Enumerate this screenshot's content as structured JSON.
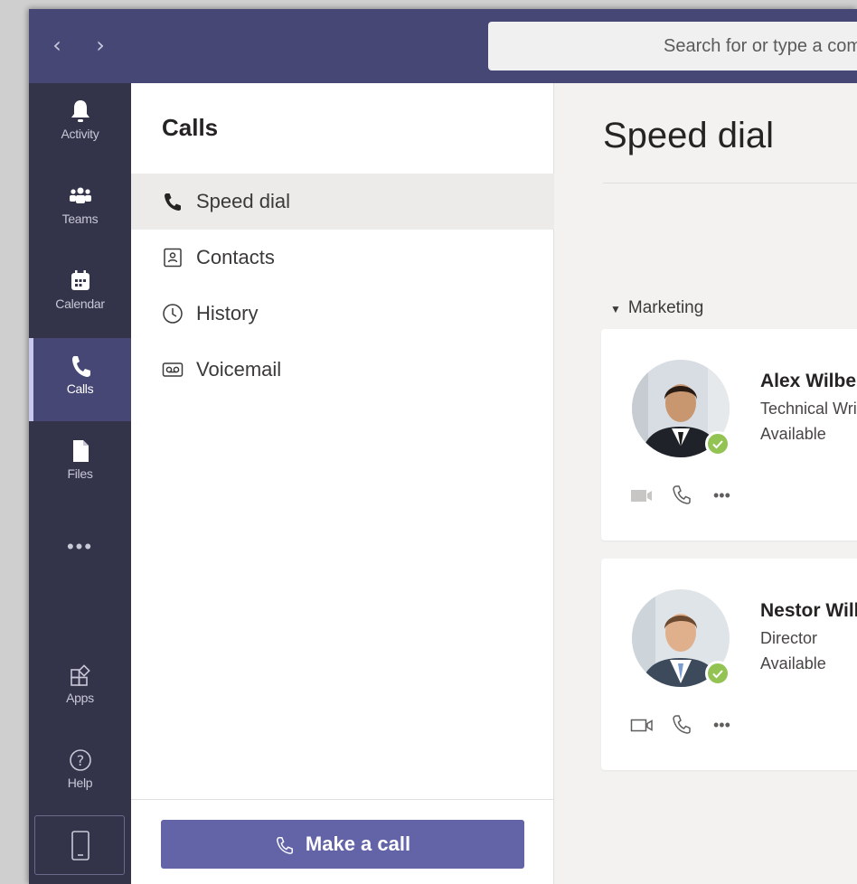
{
  "titlebar": {
    "back": "‹",
    "forward": "›",
    "search_placeholder": "Search for or type a command"
  },
  "appbar": {
    "items": [
      {
        "label": "Activity",
        "icon": "bell-icon"
      },
      {
        "label": "Teams",
        "icon": "teams-icon"
      },
      {
        "label": "Calendar",
        "icon": "calendar-icon"
      },
      {
        "label": "Calls",
        "icon": "phone-icon",
        "active": true
      },
      {
        "label": "Files",
        "icon": "file-icon"
      },
      {
        "label": "Apps",
        "icon": "apps-icon"
      },
      {
        "label": "Help",
        "icon": "help-icon"
      }
    ],
    "more": "•••"
  },
  "calls_panel": {
    "title": "Calls",
    "items": [
      {
        "label": "Speed dial",
        "icon": "phone-icon"
      },
      {
        "label": "Contacts",
        "icon": "contacts-icon"
      },
      {
        "label": "History",
        "icon": "clock-icon"
      },
      {
        "label": "Voicemail",
        "icon": "voicemail-icon"
      }
    ],
    "make_call_label": "Make a call"
  },
  "main": {
    "title": "Speed dial",
    "group": "Marketing",
    "contacts": [
      {
        "name": "Alex Wilber",
        "title": "Technical Writer",
        "status": "Available",
        "presence_color": "#92c353"
      },
      {
        "name": "Nestor Wilke",
        "title": "Director",
        "status": "Available",
        "presence_color": "#92c353"
      }
    ],
    "more": "•••"
  },
  "colors": {
    "titlebar": "#464775",
    "appbar": "#33344a",
    "accent": "#6264a7",
    "available": "#92c353"
  }
}
